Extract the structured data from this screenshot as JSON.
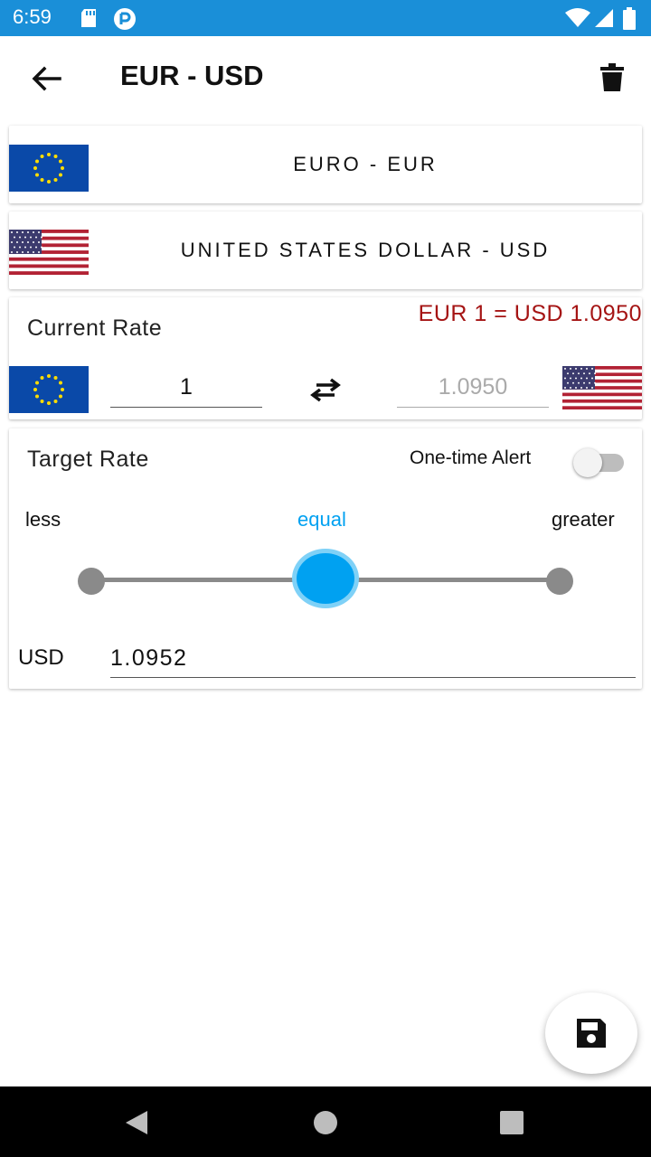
{
  "status_bar": {
    "time": "6:59"
  },
  "app_bar": {
    "title": "EUR - USD"
  },
  "base_currency": {
    "name": "EURO - EUR",
    "flag": "eu-flag"
  },
  "quote_currency": {
    "name": "UNITED STATES DOLLAR - USD",
    "flag": "us-flag"
  },
  "current_rate": {
    "title": "Current Rate",
    "rate_text": "EUR 1 = USD 1.0950",
    "base_amount": "1",
    "quote_amount": "1.0950"
  },
  "target_rate": {
    "title": "Target Rate",
    "alert_label": "One-time Alert",
    "alert_enabled": false,
    "condition_labels": [
      "less",
      "equal",
      "greater"
    ],
    "selected_condition": "equal",
    "currency": "USD",
    "value": "1.0952"
  },
  "colors": {
    "status_bar": "#1a8fd8",
    "rate_text": "#a51414",
    "accent": "#00a1f1"
  }
}
